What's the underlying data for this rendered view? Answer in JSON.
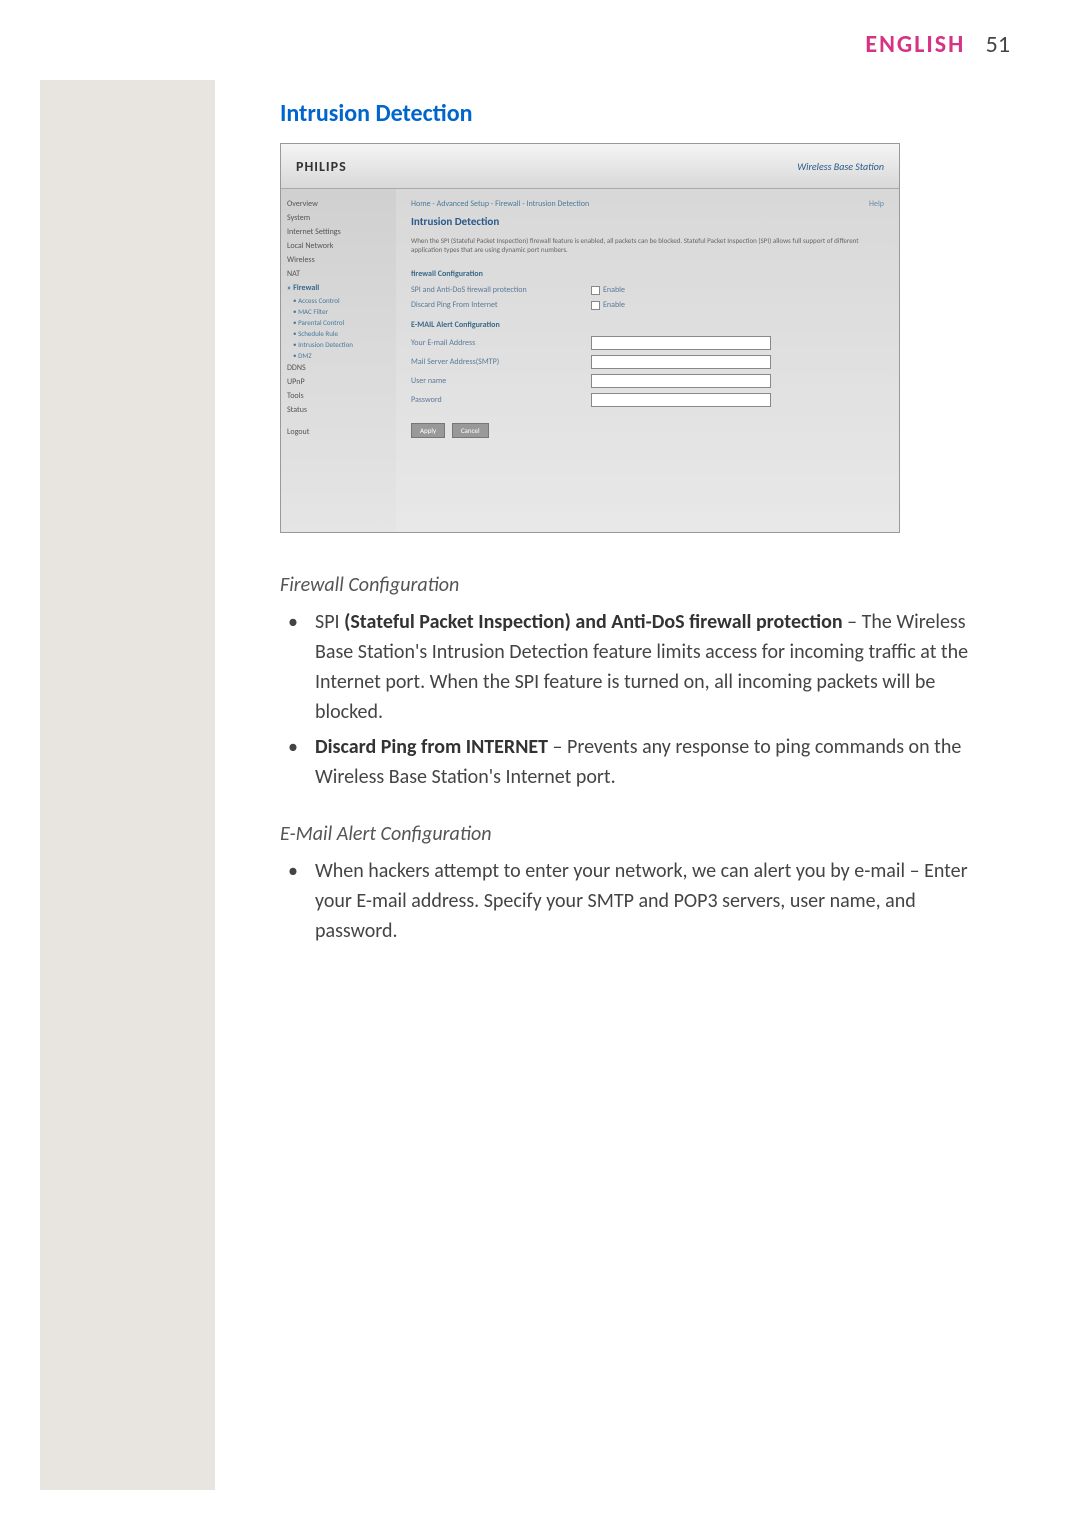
{
  "header": {
    "language": "ENGLISH",
    "page_number": "51"
  },
  "section_title": "Intrusion Detection",
  "screenshot": {
    "logo": "PHILIPS",
    "product": "Wireless Base Station",
    "sidebar": {
      "items": [
        "Overview",
        "System",
        "Internet Settings",
        "Local Network",
        "Wireless",
        "NAT"
      ],
      "firewall": "» Firewall",
      "firewall_subs": [
        "• Access Control",
        "• MAC Filter",
        "• Parental Control",
        "• Schedule Rule",
        "• Intrusion Detection",
        "• DMZ"
      ],
      "items2": [
        "DDNS",
        "UPnP",
        "Tools",
        "Status"
      ],
      "logout": "Logout"
    },
    "main": {
      "breadcrumb": "Home - Advanced Setup - Firewall - Intrusion Detection",
      "help": "Help",
      "title": "Intrusion Detection",
      "description": "When the SPI (Stateful Packet Inspection) firewall feature is enabled, all packets can be blocked. Stateful Packet Inspection (SPI) allows full support of different application types that are using dynamic port numbers.",
      "firewall_config_label": "firewall Configuration",
      "spi_label": "SPI and Anti-DoS firewall protection",
      "discard_label": "Discard Ping From Internet",
      "enable": "Enable",
      "email_config_label": "E-MAIL Alert Configuration",
      "email_address_label": "Your E-mail Address",
      "mail_server_label": "Mail Server Address(SMTP)",
      "username_label": "User name",
      "password_label": "Password",
      "apply_btn": "Apply",
      "cancel_btn": "Cancel"
    }
  },
  "body": {
    "subsection1": "Firewall Configuration",
    "bullet1_prefix": "SPI ",
    "bullet1_bold": "(Stateful Packet Inspection) and Anti-DoS firewall protection",
    "bullet1_text": " – The Wireless Base Station's Intrusion Detection feature limits access for incoming traffic at the Internet port. When the SPI feature is turned on, all incoming packets will be blocked.",
    "bullet2_bold": "Discard Ping from INTERNET",
    "bullet2_text": " – Prevents any response to ping commands on the Wireless Base Station's Internet port.",
    "subsection2": "E-Mail Alert Configuration",
    "bullet3_text": "When hackers attempt to enter your network, we can alert you by e-mail – Enter your E-mail address. Specify your SMTP and POP3 servers, user name, and password."
  }
}
